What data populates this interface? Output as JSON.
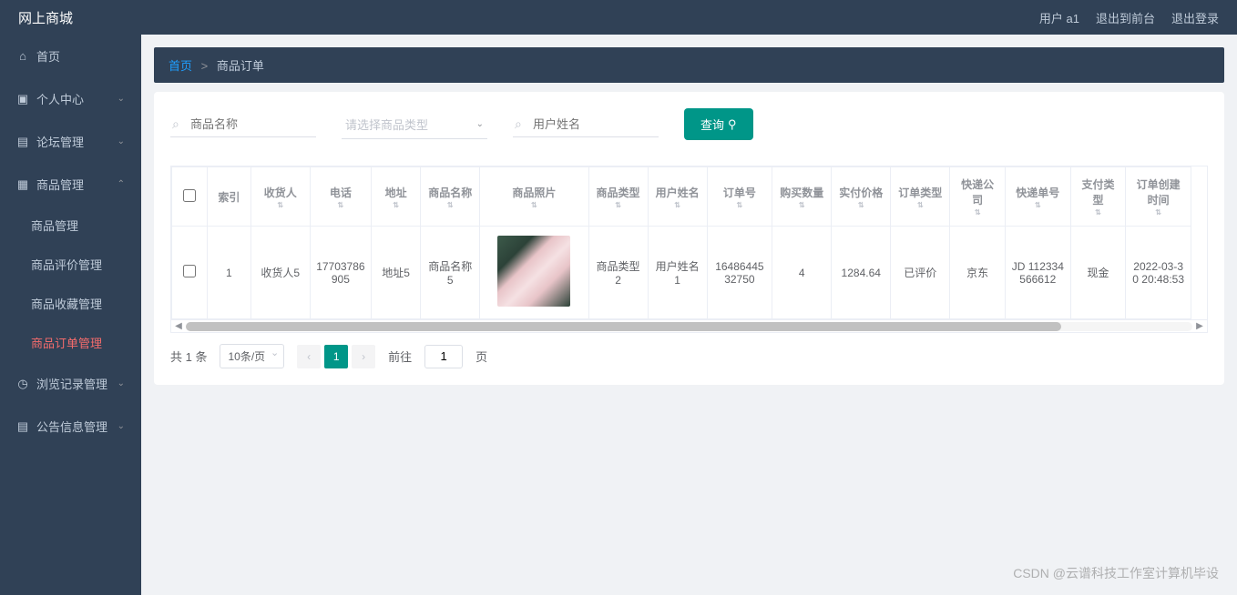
{
  "header": {
    "title": "网上商城",
    "user_label": "用户 a1",
    "exit_front": "退出到前台",
    "logout": "退出登录"
  },
  "sidebar": {
    "items": [
      {
        "label": "首页",
        "icon": "⌂",
        "expandable": false
      },
      {
        "label": "个人中心",
        "icon": "👤",
        "expandable": true
      },
      {
        "label": "论坛管理",
        "icon": "🗐",
        "expandable": true
      },
      {
        "label": "商品管理",
        "icon": "🗄",
        "expandable": true,
        "expanded": true,
        "children": [
          {
            "label": "商品管理"
          },
          {
            "label": "商品评价管理"
          },
          {
            "label": "商品收藏管理"
          },
          {
            "label": "商品订单管理",
            "active": true
          }
        ]
      },
      {
        "label": "浏览记录管理",
        "icon": "◷",
        "expandable": true
      },
      {
        "label": "公告信息管理",
        "icon": "🗎",
        "expandable": true
      }
    ]
  },
  "breadcrumb": {
    "home": "首页",
    "sep": ">",
    "current": "商品订单"
  },
  "search": {
    "name_placeholder": "商品名称",
    "type_placeholder": "请选择商品类型",
    "user_placeholder": "用户姓名",
    "query_button": "查询"
  },
  "table": {
    "headers": [
      "",
      "索引",
      "收货人",
      "电话",
      "地址",
      "商品名称",
      "商品照片",
      "商品类型",
      "用户姓名",
      "订单号",
      "购买数量",
      "实付价格",
      "订单类型",
      "快递公司",
      "快递单号",
      "支付类型",
      "订单创建时间"
    ],
    "rows": [
      {
        "index": "1",
        "receiver": "收货人5",
        "phone": "17703786905",
        "address": "地址5",
        "goods_name": "商品名称5",
        "goods_type": "商品类型2",
        "user_name": "用户姓名1",
        "order_no": "1648644532750",
        "qty": "4",
        "paid": "1284.64",
        "order_type": "已评价",
        "courier": "京东",
        "tracking": "JD 112334566612",
        "pay_type": "现金",
        "created": "2022-03-30 20:48:53"
      }
    ]
  },
  "pagination": {
    "total_text": "共 1 条",
    "page_size": "10条/页",
    "current_page": "1",
    "goto_prefix": "前往",
    "goto_suffix": "页",
    "goto_value": "1"
  },
  "watermark": "CSDN @云谱科技工作室计算机毕设"
}
